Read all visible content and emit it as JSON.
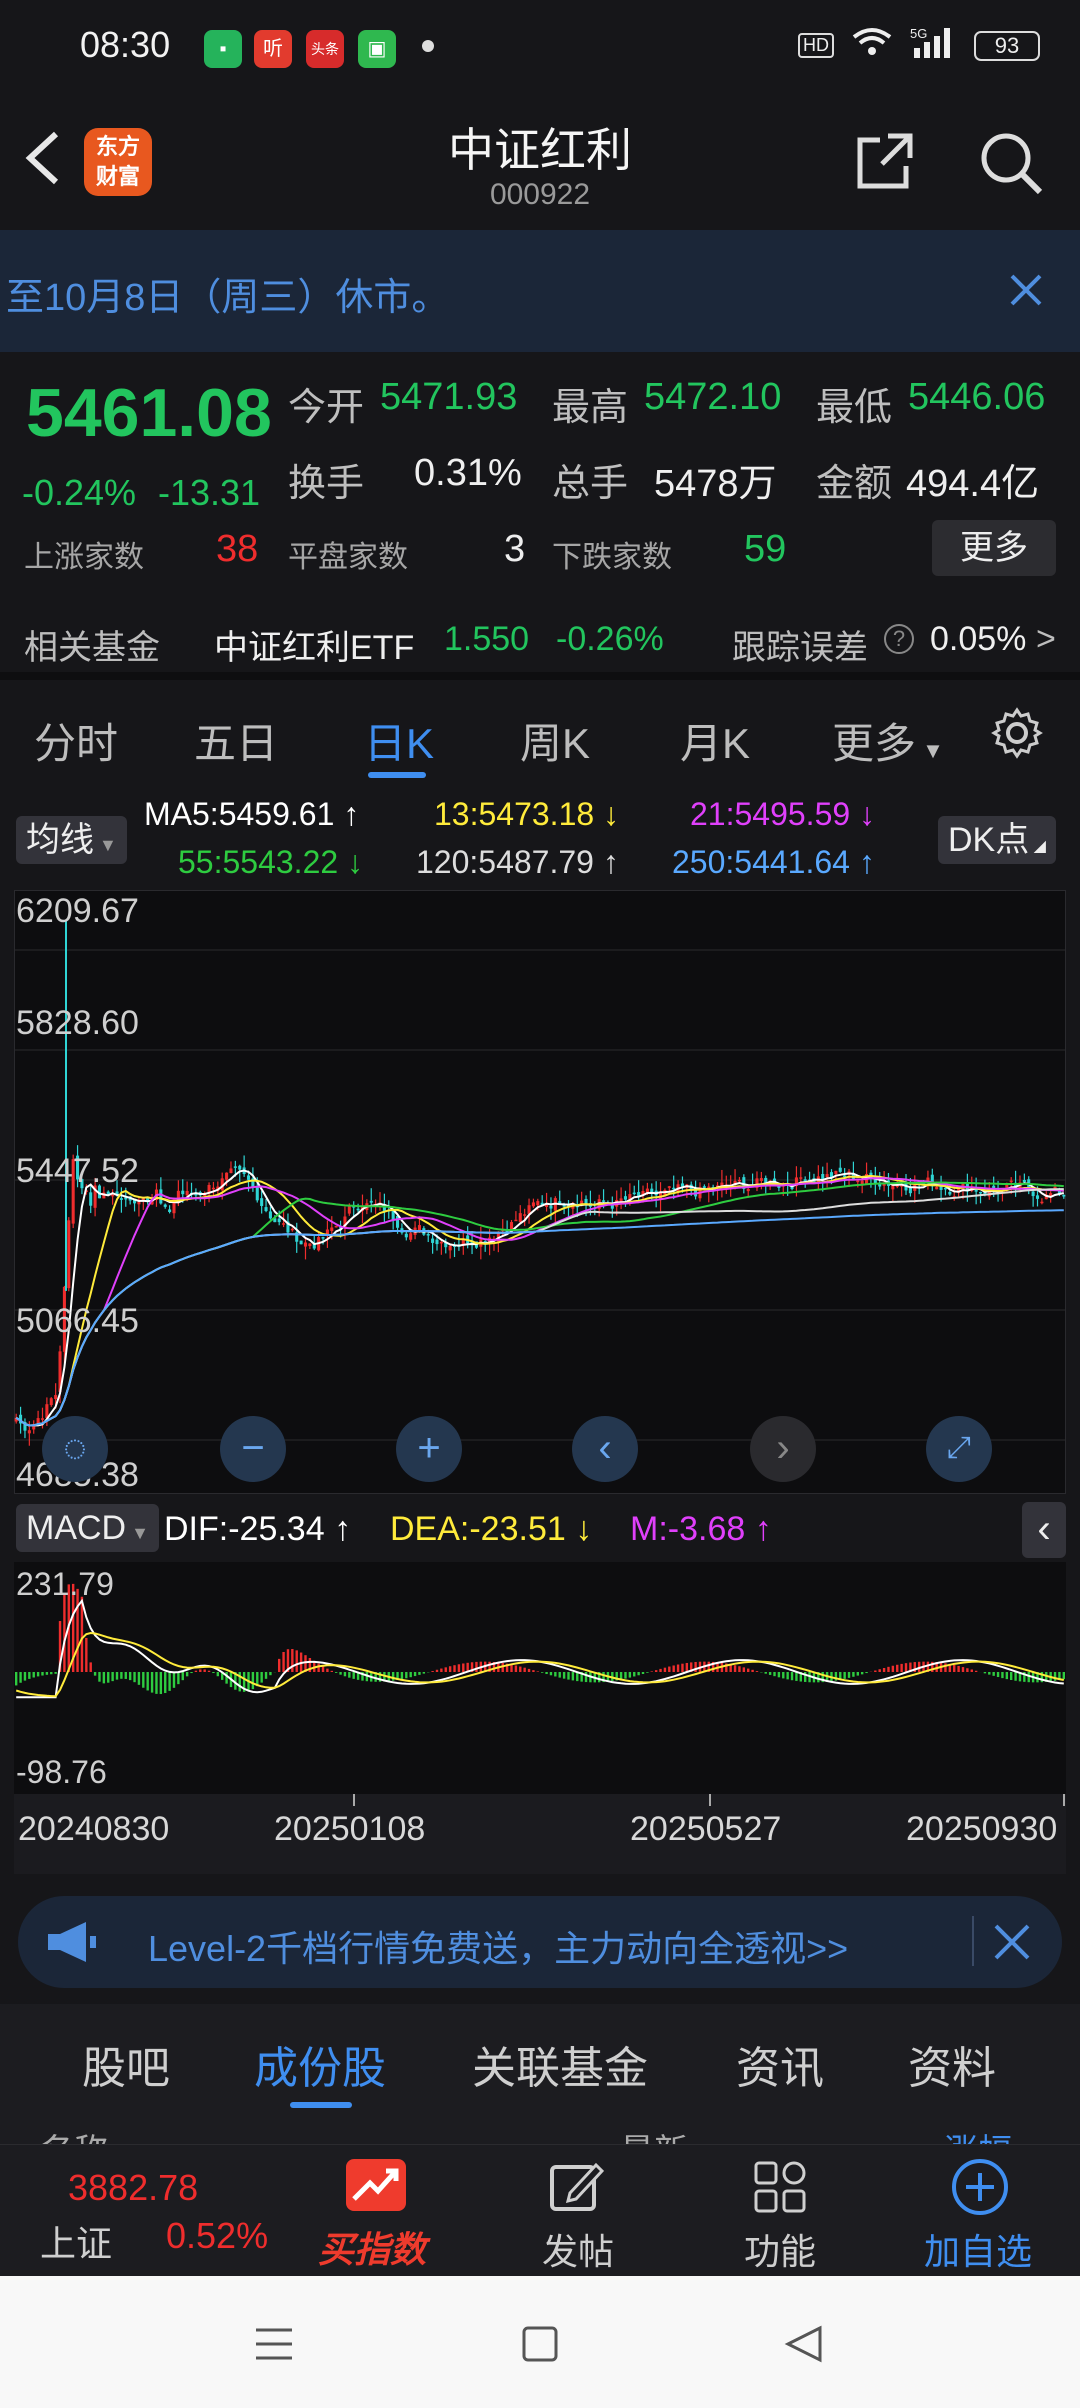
{
  "status_bar": {
    "time": "08:30",
    "battery": "93",
    "network": "5G"
  },
  "header": {
    "title": "中证红利",
    "code": "000922",
    "logo_text": "东方\n财富"
  },
  "notice": {
    "text": "至10月8日（周三）休市。"
  },
  "quote": {
    "price": "5461.08",
    "change_pct": "-0.24%",
    "change_abs": "-13.31",
    "open_label": "今开",
    "open": "5471.93",
    "high_label": "最高",
    "high": "5472.10",
    "low_label": "最低",
    "low": "5446.06",
    "turnover_label": "换手",
    "turnover": "0.31%",
    "volume_label": "总手",
    "volume": "5478万",
    "amount_label": "金额",
    "amount": "494.4亿",
    "up_label": "上涨家数",
    "up": "38",
    "flat_label": "平盘家数",
    "flat": "3",
    "down_label": "下跌家数",
    "down": "59",
    "more": "更多"
  },
  "fund": {
    "label": "相关基金",
    "name": "中证红利ETF",
    "price": "1.550",
    "change": "-0.26%",
    "track_label": "跟踪误差",
    "track_value": "0.05%",
    "arrow": ">"
  },
  "tabs": [
    "分时",
    "五日",
    "日K",
    "周K",
    "月K",
    "更多"
  ],
  "ma_legend": {
    "selector": "均线",
    "dk": "DK点",
    "ma5": "MA5:5459.61 ↑",
    "ma13": "13:5473.18 ↓",
    "ma21": "21:5495.59 ↓",
    "ma55": "55:5543.22 ↓",
    "ma120": "120:5487.79 ↑",
    "ma250": "250:5441.64 ↑"
  },
  "axis": {
    "y1": "6209.67",
    "y2": "5828.60",
    "y3": "5447.52",
    "y4": "5066.45",
    "y5": "4685.38"
  },
  "macd": {
    "selector": "MACD",
    "dif": "DIF:-25.34 ↑",
    "dea": "DEA:-23.51 ↓",
    "m": "M:-3.68 ↑",
    "ymax": "231.79",
    "ymin": "-98.76"
  },
  "dates": [
    "20240830",
    "20250108",
    "20250527",
    "20250930"
  ],
  "promo": {
    "text": "Level-2千档行情免费送，主力动向全透视>>"
  },
  "bottom_tabs": [
    "股吧",
    "成份股",
    "关联基金",
    "资讯",
    "资料"
  ],
  "column_header": {
    "name": "名称",
    "latest": "最新",
    "change": "涨幅"
  },
  "bottom_nav": {
    "index_value": "3882.78",
    "index_name": "上证",
    "index_change": "0.52%",
    "buy": "买指数",
    "post": "发帖",
    "function": "功能",
    "add": "加自选"
  },
  "colors": {
    "up": "#ef2d2d",
    "down": "#22c55e",
    "accent": "#3f8ef0",
    "ma5": "#ffffff",
    "ma13": "#ffeb3b",
    "ma21": "#e040fb",
    "ma55": "#2ecc40",
    "ma120": "#dddddd",
    "ma250": "#5aa9ff"
  }
}
